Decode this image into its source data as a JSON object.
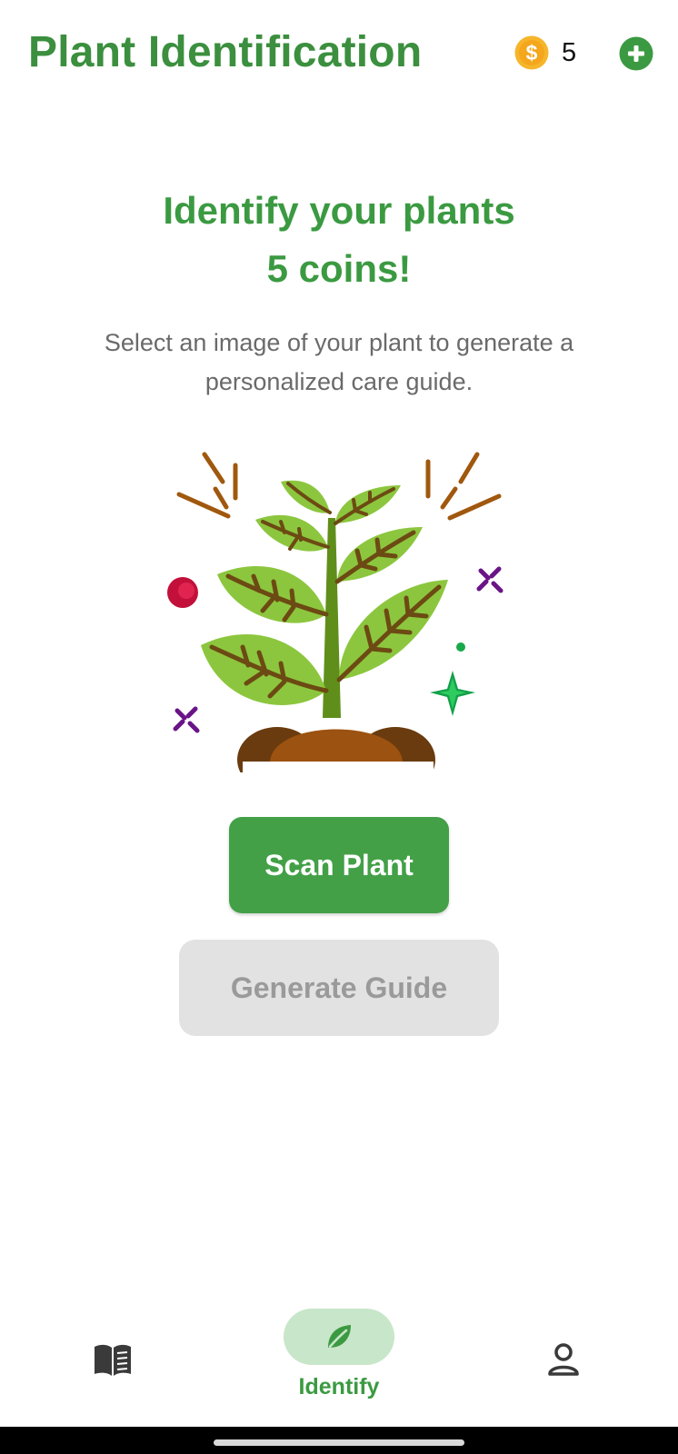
{
  "header": {
    "title": "Plant Identification",
    "coin_icon": "dollar-coin-icon",
    "coin_count": "5",
    "add_icon": "plus-circle-icon"
  },
  "main": {
    "headline_line1": "Identify your plants",
    "headline_line2": "5 coins!",
    "subtitle": "Select an image of your plant to generate a personalized care guide.",
    "illustration": "growing-plant-illustration",
    "scan_button": "Scan Plant",
    "generate_button": "Generate Guide",
    "generate_button_state": "disabled"
  },
  "bottom_nav": {
    "items": [
      {
        "icon": "book-icon",
        "label": "",
        "active": false
      },
      {
        "icon": "leaf-icon",
        "label": "Identify",
        "active": true
      },
      {
        "icon": "person-icon",
        "label": "",
        "active": false
      }
    ]
  },
  "colors": {
    "brand_green": "#3b9a41",
    "button_green": "#43a047",
    "nav_pill": "#c8e6c9",
    "coin_gold": "#f6b52a",
    "disabled_bg": "#e2e2e2",
    "disabled_text": "#9a9a9a"
  }
}
